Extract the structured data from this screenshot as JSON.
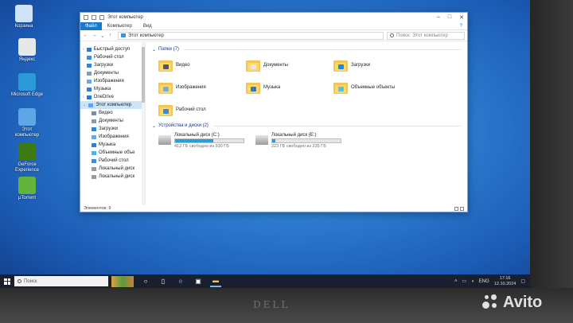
{
  "desktop": {
    "icons": [
      {
        "label": "Корзина",
        "icon": "recycle-bin-icon",
        "color": "#cfe3f7"
      },
      {
        "label": "Яндекс",
        "icon": "yandex-browser-icon",
        "color": "#e8e8e8"
      },
      {
        "label": "Microsoft Edge",
        "icon": "edge-icon",
        "color": "#2a9ad8"
      },
      {
        "label": "Этот компьютер",
        "icon": "computer-icon",
        "color": "#5fa6e6"
      },
      {
        "label": "GeForce Experience",
        "icon": "nvidia-icon",
        "color": "#3d7a12"
      },
      {
        "label": "µTorrent",
        "icon": "utorrent-icon",
        "color": "#62b53a"
      }
    ]
  },
  "window": {
    "title": "Этот компьютер",
    "controls": [
      "–",
      "□",
      "✕"
    ],
    "ribbon_tabs": [
      "Файл",
      "Компьютер",
      "Вид"
    ],
    "address": "Этот компьютер",
    "search_placeholder": "Поиск: Этот компьютер",
    "status": "Элементов: 9"
  },
  "nav": [
    {
      "label": "Быстрый доступ",
      "level": "group",
      "icon": "star-icon",
      "color": "#2e7bd6"
    },
    {
      "label": "Рабочий стол",
      "level": "item",
      "icon": "desktop-icon",
      "color": "#3e8fd8"
    },
    {
      "label": "Загрузки",
      "level": "item",
      "icon": "downloads-icon",
      "color": "#2f87d5"
    },
    {
      "label": "Документы",
      "level": "item",
      "icon": "documents-icon",
      "color": "#8d9aa8"
    },
    {
      "label": "Изображения",
      "level": "item",
      "icon": "pictures-icon",
      "color": "#6fa8d8"
    },
    {
      "label": "Музыка",
      "level": "item",
      "icon": "music-icon",
      "color": "#3b7cc7"
    },
    {
      "label": "OneDrive",
      "level": "group",
      "icon": "onedrive-icon",
      "color": "#1e7fd8"
    },
    {
      "label": "Этот компьютер",
      "level": "group",
      "icon": "computer-icon",
      "color": "#5fa6e6"
    },
    {
      "label": "Видео",
      "level": "sub",
      "icon": "video-icon",
      "color": "#7e8b99"
    },
    {
      "label": "Документы",
      "level": "sub",
      "icon": "documents-icon",
      "color": "#8d9aa8"
    },
    {
      "label": "Загрузки",
      "level": "sub",
      "icon": "downloads-icon",
      "color": "#2f87d5"
    },
    {
      "label": "Изображения",
      "level": "sub",
      "icon": "pictures-icon",
      "color": "#6fa8d8"
    },
    {
      "label": "Музыка",
      "level": "sub",
      "icon": "music-icon",
      "color": "#3b7cc7"
    },
    {
      "label": "Объемные объе",
      "level": "sub",
      "icon": "3d-objects-icon",
      "color": "#4cb3e8"
    },
    {
      "label": "Рабочий стол",
      "level": "sub",
      "icon": "desktop-icon",
      "color": "#3e8fd8"
    },
    {
      "label": "Локальный диск",
      "level": "sub",
      "icon": "drive-icon",
      "color": "#9a9a9a"
    },
    {
      "label": "Локальный диск",
      "level": "sub",
      "icon": "drive-icon",
      "color": "#9a9a9a"
    }
  ],
  "folders_header": "Папки (7)",
  "folders": [
    {
      "label": "Видео",
      "icon": "video-folder-icon",
      "badge": "#4a5a6a"
    },
    {
      "label": "Документы",
      "icon": "documents-folder-icon",
      "badge": "#dfe7ee"
    },
    {
      "label": "Загрузки",
      "icon": "downloads-folder-icon",
      "badge": "#1e88e5"
    },
    {
      "label": "Изображения",
      "icon": "pictures-folder-icon",
      "badge": "#6fb0e8"
    },
    {
      "label": "Музыка",
      "icon": "music-folder-icon",
      "badge": "#2a7bd0"
    },
    {
      "label": "Объемные объекты",
      "icon": "3d-objects-folder-icon",
      "badge": "#4cc3f0"
    },
    {
      "label": "Рабочий стол",
      "icon": "desktop-folder-icon",
      "badge": "#2f8ee0"
    }
  ],
  "drives_header": "Устройства и диски (2)",
  "drives": [
    {
      "label": "Локальный диск (C:)",
      "free_text": "412 ГБ свободно из 930 ГБ",
      "used_fraction": 0.56
    },
    {
      "label": "Локальный диск (E:)",
      "free_text": "223 ГБ свободно из 235 ГБ",
      "used_fraction": 0.05
    }
  ],
  "taskbar": {
    "search_placeholder": "Поиск",
    "lang": "ENG",
    "time": "17:16",
    "date": "12.10.2024"
  },
  "brand": "DELL",
  "watermark": "Avito"
}
